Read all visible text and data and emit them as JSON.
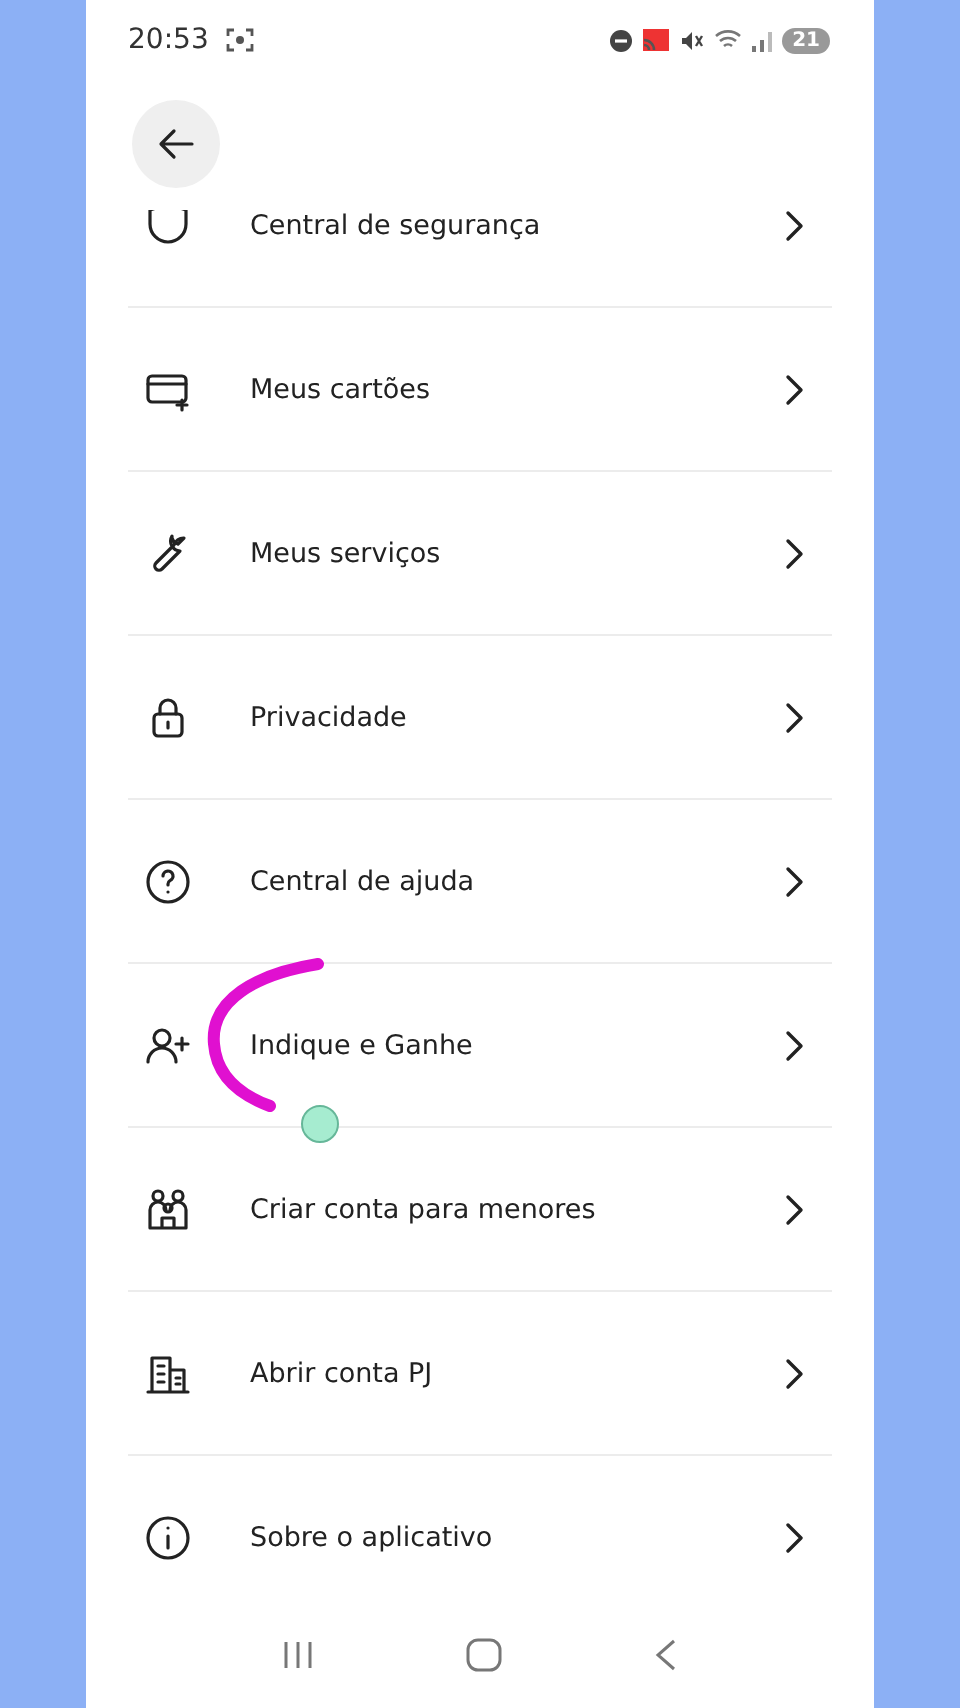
{
  "status_bar": {
    "time": "20:53",
    "battery": "21"
  },
  "menu_items": [
    {
      "label": "Central de segurança"
    },
    {
      "label": "Meus cartões"
    },
    {
      "label": "Meus serviços"
    },
    {
      "label": "Privacidade"
    },
    {
      "label": "Central de ajuda"
    },
    {
      "label": "Indique e Ganhe"
    },
    {
      "label": "Criar conta para menores"
    },
    {
      "label": "Abrir conta PJ"
    },
    {
      "label": "Sobre o aplicativo"
    }
  ]
}
